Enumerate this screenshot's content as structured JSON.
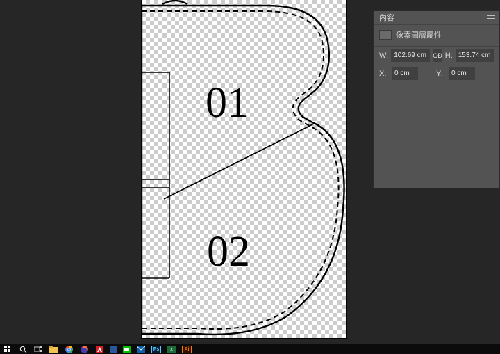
{
  "canvas": {
    "label_1": "01",
    "label_2": "02"
  },
  "panel": {
    "tab_title": "內容",
    "section_title": "像素圖層屬性",
    "w_label": "W:",
    "w_value": "102.69 cm",
    "link_label": "GĐ",
    "h_label": "H:",
    "h_value": "153.74 cm",
    "x_label": "X:",
    "x_value": "0 cm",
    "y_label": "Y:",
    "y_value": "0 cm"
  },
  "taskbar": {
    "ps": "Ps",
    "ai": "Ai",
    "xl": "x"
  }
}
